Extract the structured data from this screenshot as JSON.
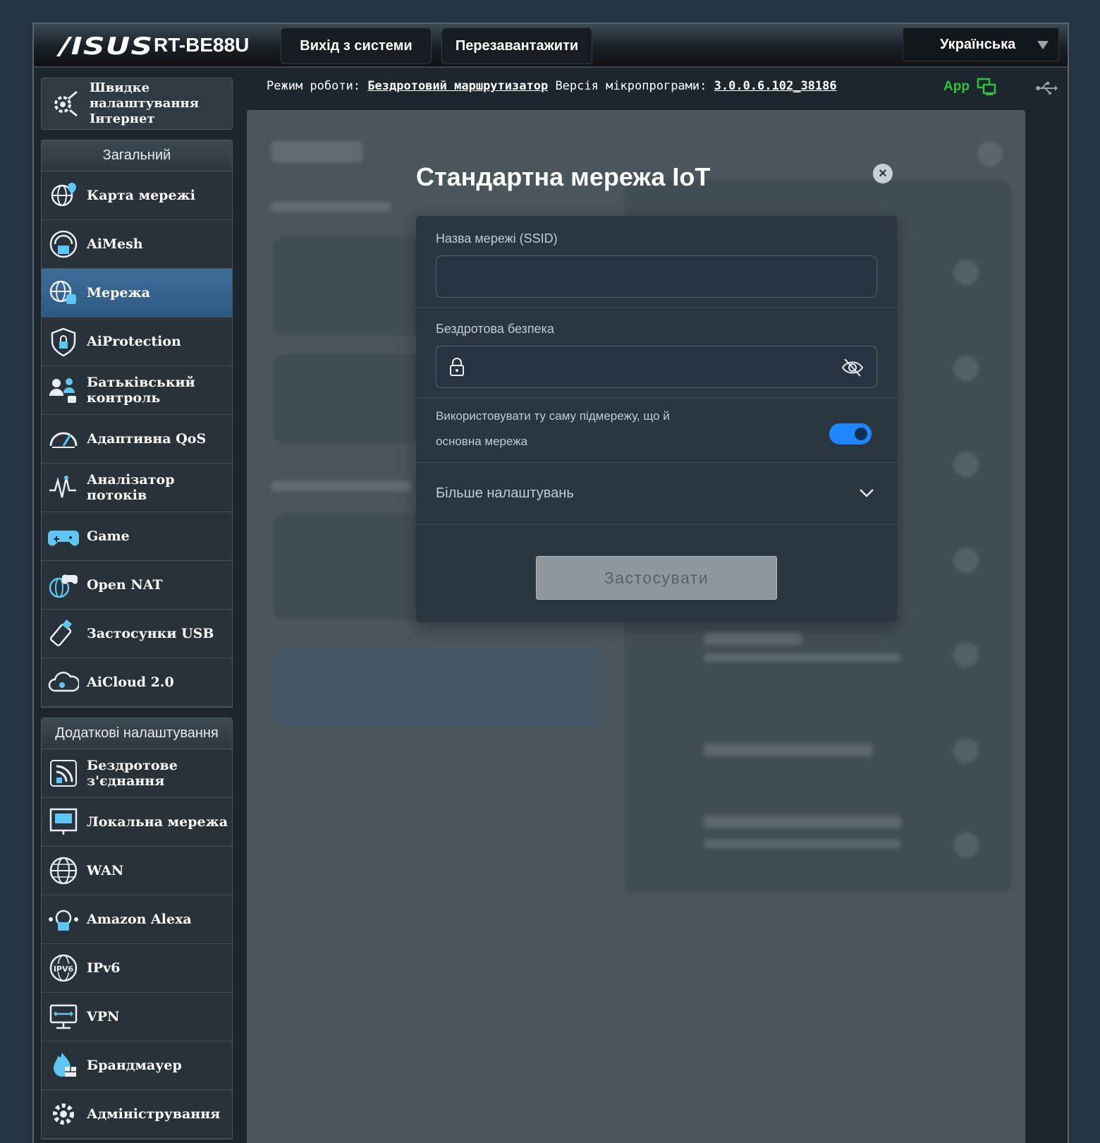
{
  "header": {
    "brand": "/ISUS",
    "model": "RT-BE88U",
    "logout_label": "Вихід з системи",
    "reboot_label": "Перезавантажити",
    "language": "Українська"
  },
  "status": {
    "mode_label": "Режим роботи:",
    "mode_value": "Бездротовий маршрутизатор",
    "firmware_label": "Версія мікропрограми:",
    "firmware_value": "3.0.0.6.102_38186",
    "app_label": "App"
  },
  "sidebar": {
    "qis_label": "Швидке налаштування Інтернет",
    "general_title": "Загальний",
    "general_items": [
      {
        "label": "Карта мережі",
        "icon": "network-map-icon"
      },
      {
        "label": "AiMesh",
        "icon": "aimesh-icon"
      },
      {
        "label": "Мережа",
        "icon": "network-icon"
      },
      {
        "label": "AiProtection",
        "icon": "aiprotection-icon"
      },
      {
        "label": "Батьківський контроль",
        "icon": "parental-control-icon"
      },
      {
        "label": "Адаптивна QoS",
        "icon": "qos-icon"
      },
      {
        "label": "Аналізатор потоків",
        "icon": "traffic-analyzer-icon"
      },
      {
        "label": "Game",
        "icon": "game-icon"
      },
      {
        "label": "Open NAT",
        "icon": "open-nat-icon"
      },
      {
        "label": "Застосунки USB",
        "icon": "usb-apps-icon"
      },
      {
        "label": "AiCloud 2.0",
        "icon": "aicloud-icon"
      }
    ],
    "advanced_title": "Додаткові налаштування",
    "advanced_items": [
      {
        "label": "Бездротове з'єднання",
        "icon": "wireless-icon"
      },
      {
        "label": "Локальна мережа",
        "icon": "lan-icon"
      },
      {
        "label": "WAN",
        "icon": "wan-icon"
      },
      {
        "label": "Amazon Alexa",
        "icon": "alexa-icon"
      },
      {
        "label": "IPv6",
        "icon": "ipv6-icon"
      },
      {
        "label": "VPN",
        "icon": "vpn-icon"
      },
      {
        "label": "Брандмауер",
        "icon": "firewall-icon"
      },
      {
        "label": "Адміністрування",
        "icon": "administration-icon"
      }
    ]
  },
  "modal": {
    "title": "Стандартна мережа IoT",
    "ssid_label": "Назва мережі (SSID)",
    "ssid_value": "",
    "security_label": "Бездротова безпека",
    "security_value": "",
    "same_subnet_label_line1": "Використовувати ту саму підмережу, що й",
    "same_subnet_label_line2": "основна мережа",
    "same_subnet_enabled": true,
    "more_settings_label": "Більше налаштувань",
    "apply_label": "Застосувати"
  },
  "colors": {
    "accent": "#1e86ff",
    "app_green": "#29c43c",
    "active_item": "#2d5a84"
  }
}
